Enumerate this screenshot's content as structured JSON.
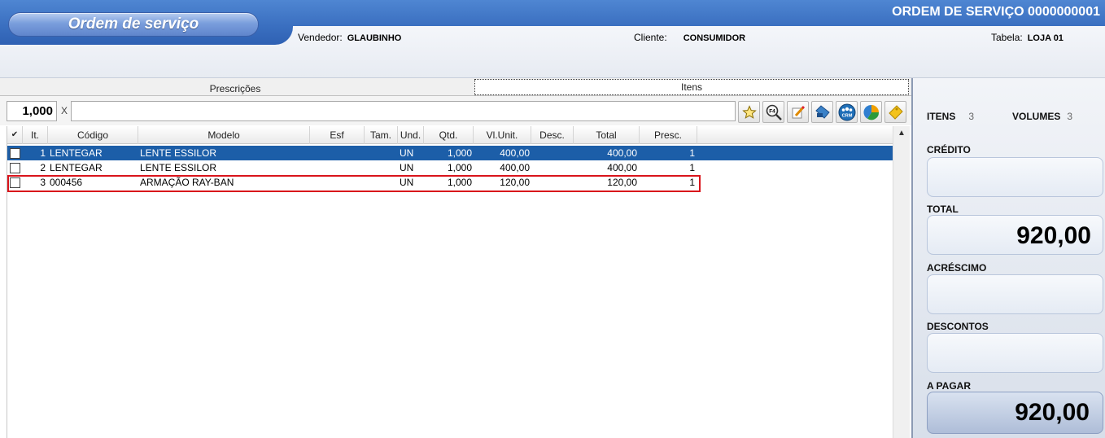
{
  "header": {
    "title": "Ordem de serviço",
    "os_number": "ORDEM DE SERVIÇO 0000000001",
    "vendedor_label": "Vendedor:",
    "vendedor_value": "GLAUBINHO",
    "cliente_label": "Cliente:",
    "cliente_value": "CONSUMIDOR",
    "tabela_label": "Tabela:",
    "tabela_value": "LOJA 01"
  },
  "tabs": [
    {
      "label": "Prescrições",
      "active": false
    },
    {
      "label": "Itens",
      "active": true
    }
  ],
  "entry": {
    "quantity": "1,000",
    "multiply": "X",
    "code_value": "",
    "toolbar_icons": [
      "star-icon",
      "f4-search-icon",
      "edit-icon",
      "tag-icon",
      "crm-icon",
      "pie-chart-icon",
      "coupon-icon"
    ],
    "f4_label": "F4",
    "crm_label": "CRM"
  },
  "grid": {
    "columns": [
      "It.",
      "Código",
      "Modelo",
      "Esf",
      "Tam.",
      "Und.",
      "Qtd.",
      "Vl.Unit.",
      "Desc.",
      "Total",
      "Presc."
    ],
    "check_header": "✔",
    "rows": [
      {
        "it": "1",
        "codigo": "LENTEGAR",
        "modelo": "LENTE ESSILOR",
        "esf": "",
        "tam": "",
        "und": "UN",
        "qtd": "1,000",
        "vl_unit": "400,00",
        "desc": "",
        "total": "400,00",
        "presc": "1",
        "selected": true,
        "highlighted": false
      },
      {
        "it": "2",
        "codigo": "LENTEGAR",
        "modelo": "LENTE ESSILOR",
        "esf": "",
        "tam": "",
        "und": "UN",
        "qtd": "1,000",
        "vl_unit": "400,00",
        "desc": "",
        "total": "400,00",
        "presc": "1",
        "selected": false,
        "highlighted": false
      },
      {
        "it": "3",
        "codigo": "000456",
        "modelo": "ARMAÇÃO RAY-BAN",
        "esf": "",
        "tam": "",
        "und": "UN",
        "qtd": "1,000",
        "vl_unit": "120,00",
        "desc": "",
        "total": "120,00",
        "presc": "1",
        "selected": false,
        "highlighted": true
      }
    ]
  },
  "summary": {
    "itens_label": "ITENS",
    "itens_value": "3",
    "volumes_label": "VOLUMES",
    "volumes_value": "3",
    "credito_label": "CRÉDITO",
    "credito_value": "",
    "total_label": "TOTAL",
    "total_value": "920,00",
    "acrescimo_label": "ACRÉSCIMO",
    "acrescimo_value": "",
    "descontos_label": "DESCONTOS",
    "descontos_value": "",
    "a_pagar_label": "A PAGAR",
    "a_pagar_value": "920,00"
  },
  "colors": {
    "header_blue": "#3a6fc0",
    "selected_row": "#1c5ea8",
    "highlight_border": "#d9141b"
  }
}
